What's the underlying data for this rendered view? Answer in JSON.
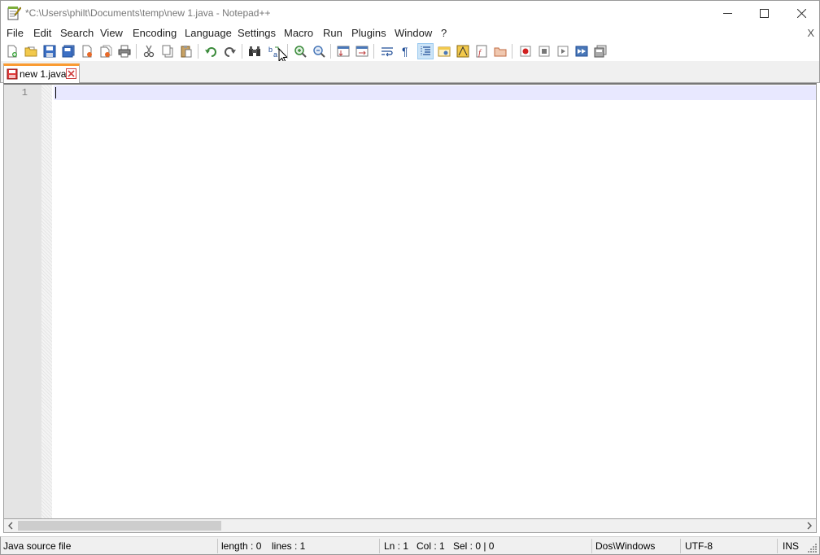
{
  "window": {
    "title": "*C:\\Users\\philt\\Documents\\temp\\new 1.java - Notepad++"
  },
  "menu": {
    "items": [
      {
        "label": "File"
      },
      {
        "label": "Edit"
      },
      {
        "label": "Search"
      },
      {
        "label": "View"
      },
      {
        "label": "Encoding"
      },
      {
        "label": "Language"
      },
      {
        "label": "Settings"
      },
      {
        "label": "Macro"
      },
      {
        "label": "Run"
      },
      {
        "label": "Plugins"
      },
      {
        "label": "Window"
      },
      {
        "label": "?"
      }
    ],
    "close_label": "X"
  },
  "tabs": [
    {
      "label": "new 1.java"
    }
  ],
  "editor": {
    "line_numbers": [
      "1"
    ],
    "content": ""
  },
  "status": {
    "file_type": "Java source file",
    "length": "length : 0",
    "lines": "lines : 1",
    "ln": "Ln : 1",
    "col": "Col : 1",
    "sel": "Sel : 0 | 0",
    "eol": "Dos\\Windows",
    "encoding": "UTF-8",
    "mode": "INS"
  },
  "colors": {
    "tab_accent": "#fa9b32",
    "current_line": "#e8e8ff",
    "gutter": "#e4e4e4"
  }
}
